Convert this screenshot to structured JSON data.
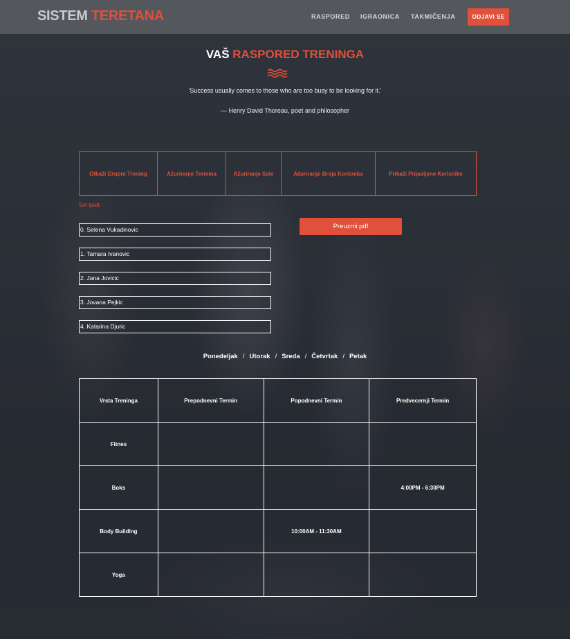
{
  "header": {
    "brand_main": "SISTEM",
    "brand_accent": "TERETANA",
    "nav": [
      "RASPORED",
      "IGRAONICA",
      "TAKMIČENJA"
    ],
    "logout": "ODJAVI SE"
  },
  "hero": {
    "title_main": "VAŠ",
    "title_accent": "RASPORED TRENINGA",
    "quote": "'Success usually comes to those who are too busy to be looking for it.'",
    "author": "— Henry David Thoreau, poet and philosopher"
  },
  "actions": [
    "Otkaži Grupni Trening",
    "Ažuriranje Termina",
    "Ažuriranje Sale",
    "Ažuriranje Broja Korisnika",
    "Prikaži Prijavljene Korisnike"
  ],
  "people": {
    "label": "Svi ljudi:",
    "list": [
      "0. Selena Vukadinovic",
      "1. Tamara Ivanovic",
      "2. Jana Jovicic",
      "3. Jovana Pejkic",
      "4. Katarina Djuric"
    ]
  },
  "pdf_button": "Preuzmi pdf",
  "days": [
    "Ponedeljak",
    "Utorak",
    "Sreda",
    "Četvrtak",
    "Petak"
  ],
  "schedule": {
    "headers": [
      "Vrsta Treninga",
      "Prepodnevni Termin",
      "Popodnevni Termin",
      "Predvecernji Termin"
    ],
    "rows": [
      [
        "Fitnes",
        "",
        "",
        ""
      ],
      [
        "Boks",
        "",
        "",
        "4:00PM - 6:30PM"
      ],
      [
        "Body Building",
        "",
        "10:00AM - 11:30AM",
        ""
      ],
      [
        "Yoga",
        "",
        "",
        ""
      ]
    ]
  },
  "colors": {
    "accent": "#e0503a",
    "header_bg": "#585a60"
  }
}
